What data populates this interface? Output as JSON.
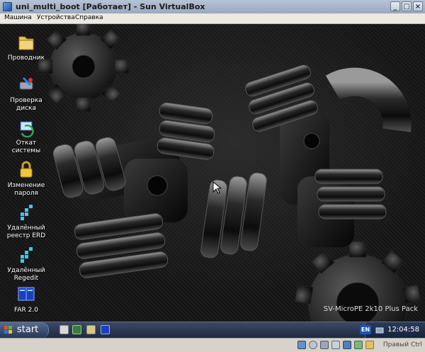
{
  "window": {
    "title": "uni_multi_boot [Работает] - Sun VirtualBox",
    "buttons": {
      "minimize": "_",
      "maximize": "□",
      "close": "×"
    }
  },
  "menu": [
    {
      "label": "Машина"
    },
    {
      "label": "Устройства"
    },
    {
      "label": "Справка"
    }
  ],
  "desktop_icons": [
    {
      "label": "Проводник",
      "icon": "folder-icon"
    },
    {
      "label": "Проверка диска",
      "icon": "disk-check-icon"
    },
    {
      "label": "Откат системы",
      "icon": "system-restore-icon"
    },
    {
      "label": "Изменение пароля",
      "icon": "lock-icon"
    },
    {
      "label": "Удалённый реестр ERD",
      "icon": "registry-icon"
    },
    {
      "label": "Удалённый Regedit",
      "icon": "regedit-icon"
    },
    {
      "label": "FAR 2.0",
      "icon": "far-manager-icon"
    }
  ],
  "branding": "SV-MicroPE 2k10 Plus Pack",
  "taskbar": {
    "start_label": "start",
    "language": "EN",
    "clock": "12:04:58"
  },
  "statusbar": {
    "text": "Правый Ctrl"
  }
}
